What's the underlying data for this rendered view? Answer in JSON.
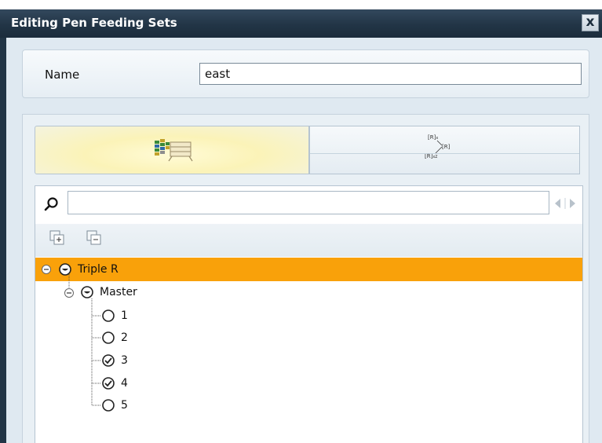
{
  "window": {
    "title": "Editing Pen Feeding Sets",
    "close_label": "x"
  },
  "form": {
    "name_label": "Name",
    "name_value": "east"
  },
  "tabs": [
    {
      "icon": "feeding-pens-icon",
      "selected": true
    },
    {
      "icon": "rules-diagram-icon",
      "selected": false
    }
  ],
  "search": {
    "placeholder": "",
    "value": ""
  },
  "toolbar": {
    "expand_icon": "expand-all-icon",
    "collapse_icon": "collapse-all-icon"
  },
  "tree": {
    "root": {
      "label": "Triple R",
      "selected": true
    },
    "group": {
      "label": "Master"
    },
    "pens": [
      {
        "label": "1",
        "checked": false
      },
      {
        "label": "2",
        "checked": false
      },
      {
        "label": "3",
        "checked": true
      },
      {
        "label": "4",
        "checked": true
      },
      {
        "label": "5",
        "checked": false
      }
    ]
  },
  "colors": {
    "title_bar": "#223546",
    "selection": "#f9a10a",
    "panel": "#e9f0f5"
  }
}
